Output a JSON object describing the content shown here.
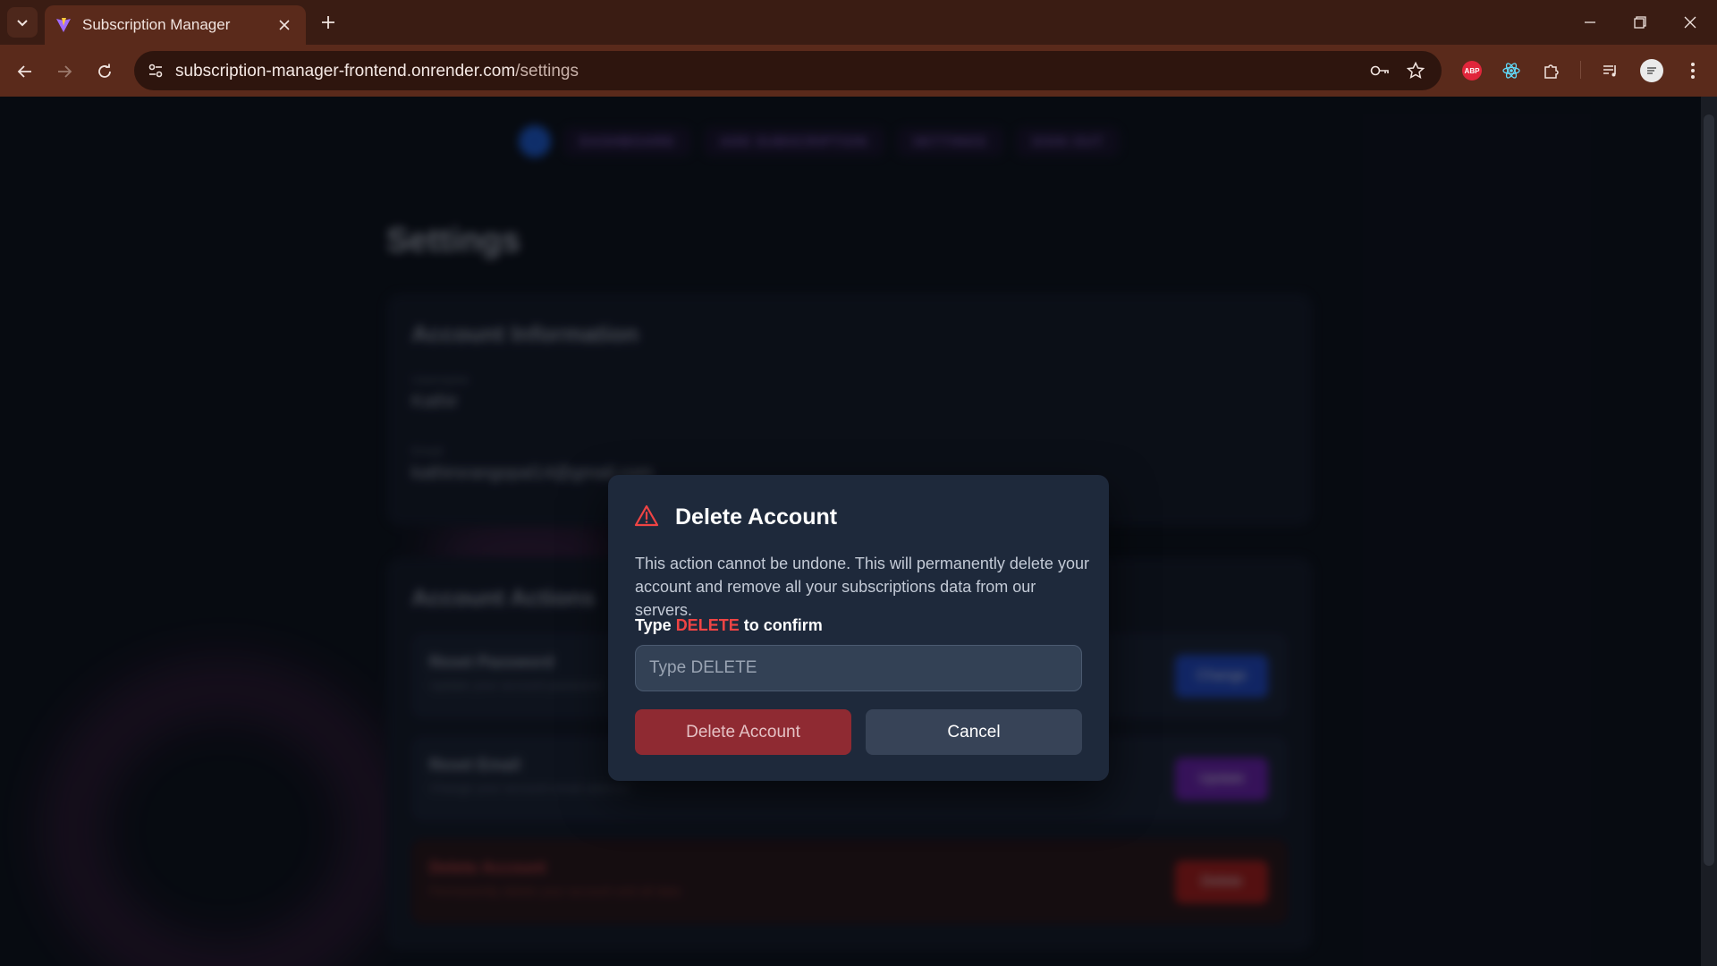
{
  "browser": {
    "tab_title": "Subscription Manager",
    "url_host": "subscription-manager-frontend.onrender.com",
    "url_path": "/settings",
    "extension_abp_label": "ABP"
  },
  "nav": {
    "items": [
      "DASHBOARD",
      "ADD SUBSCRIPTION",
      "SETTINGS",
      "SIGN OUT"
    ]
  },
  "settings": {
    "title": "Settings",
    "account_info": {
      "heading": "Account Information",
      "username_label": "Username",
      "username_value": "Kathir",
      "email_label": "Email",
      "email_value": "kathirsrangopal14@gmail.com"
    },
    "account_actions": {
      "heading": "Account Actions",
      "rows": [
        {
          "title": "Reset Password",
          "subtitle": "Update your account password",
          "button": "Change",
          "color": "#1d3fa8"
        },
        {
          "title": "Reset Email",
          "subtitle": "Change your account email address",
          "button": "Update",
          "color": "#5b1f96"
        },
        {
          "title": "Delete Account",
          "subtitle": "Permanently delete your account and all data",
          "button": "Delete",
          "color": "#8e1b1b"
        }
      ]
    }
  },
  "modal": {
    "title": "Delete Account",
    "description": "This action cannot be undone. This will permanently delete your account and remove all your subscriptions data from our servers.",
    "confirm_prefix": "Type ",
    "confirm_keyword": "DELETE",
    "confirm_suffix": " to confirm",
    "input_placeholder": "Type DELETE",
    "input_value": "",
    "delete_button": "Delete Account",
    "cancel_button": "Cancel",
    "colors": {
      "danger": "#ef4444",
      "delete_bg": "#8f2a32",
      "modal_bg": "#1e293b"
    }
  }
}
